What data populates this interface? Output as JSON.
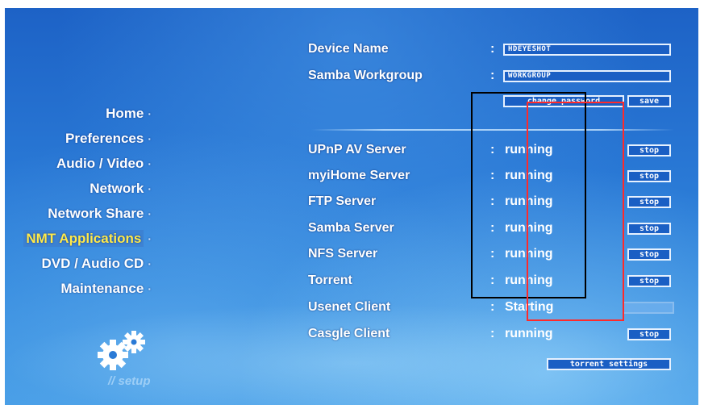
{
  "menu": {
    "items": [
      {
        "label": "Home"
      },
      {
        "label": "Preferences"
      },
      {
        "label": "Audio / Video"
      },
      {
        "label": "Network"
      },
      {
        "label": "Network Share"
      },
      {
        "label": "NMT Applications"
      },
      {
        "label": "DVD / Audio CD"
      },
      {
        "label": "Maintenance"
      }
    ],
    "active_index": 5,
    "bullet": "·",
    "footer": "// setup",
    "icon": "gears-icon"
  },
  "settings": {
    "device_name_label": "Device Name",
    "device_name_value": "HDEYESHOT",
    "workgroup_label": "Samba Workgroup",
    "workgroup_value": "WORKGROUP",
    "colon": ":",
    "change_password": "change password",
    "save": "save"
  },
  "services": [
    {
      "name": "UPnP AV Server",
      "status": "running",
      "action": "stop"
    },
    {
      "name": "myiHome Server",
      "status": "running",
      "action": "stop"
    },
    {
      "name": "FTP Server",
      "status": "running",
      "action": "stop"
    },
    {
      "name": "Samba Server",
      "status": "running",
      "action": "stop"
    },
    {
      "name": "NFS Server",
      "status": "running",
      "action": "stop"
    },
    {
      "name": "Torrent",
      "status": "running",
      "action": "stop"
    },
    {
      "name": "Usenet Client",
      "status": "Starting",
      "action": ""
    },
    {
      "name": "Casgle Client",
      "status": "running",
      "action": "stop"
    }
  ],
  "torrent_settings": "torrent settings",
  "colors": {
    "background": "#2a7ad6",
    "active_menu": "#ffe94a",
    "button_bg": "#1a5fc4",
    "black_box": "#000000",
    "red_box": "#ff2a2a"
  }
}
